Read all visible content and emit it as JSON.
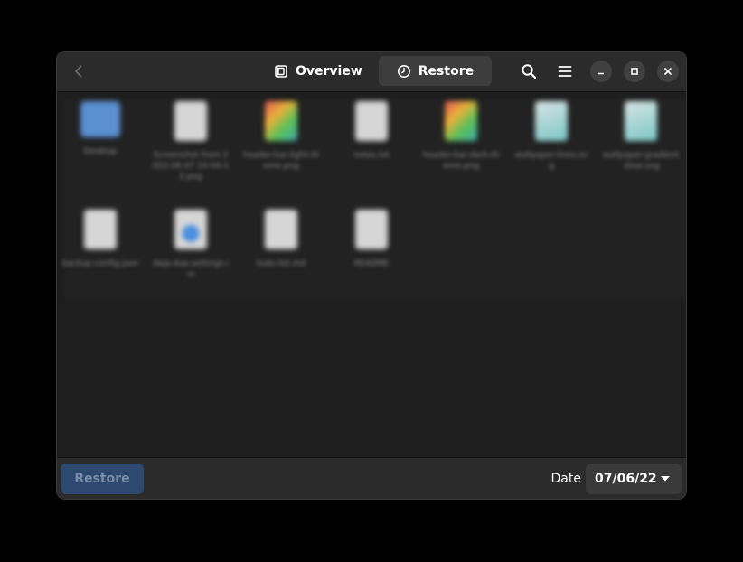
{
  "header": {
    "tabs": [
      {
        "label": "Overview",
        "icon": "overview-icon",
        "active": false
      },
      {
        "label": "Restore",
        "icon": "clock-icon",
        "active": true
      }
    ]
  },
  "files": [
    {
      "name": "Desktop",
      "icon": "folder-icon"
    },
    {
      "name": "Screenshot from 2022-06-07 10-04-12.png",
      "icon": "file-icon"
    },
    {
      "name": "header-bar-light-theme.png",
      "icon": "image-icon"
    },
    {
      "name": "notes.txt",
      "icon": "file-icon"
    },
    {
      "name": "header-bar-dark-theme.png",
      "icon": "image-icon"
    },
    {
      "name": "wallpaper-lines.svg",
      "icon": "image-icon"
    },
    {
      "name": "wallpaper-gradient-blue.svg",
      "icon": "image-icon"
    },
    {
      "name": "backup-config.json",
      "icon": "file-icon"
    },
    {
      "name": "deja-dup-settings.ini",
      "icon": "file-icon"
    },
    {
      "name": "todo-list.md",
      "icon": "file-icon"
    },
    {
      "name": "README",
      "icon": "file-icon"
    }
  ],
  "footer": {
    "restore_label": "Restore",
    "date_label": "Date",
    "date_value": "07/06/22"
  },
  "colors": {
    "accent_disabled": "#2d4970",
    "window_bg": "#1e1e1e",
    "headerbar_bg": "#2b2b2b"
  }
}
